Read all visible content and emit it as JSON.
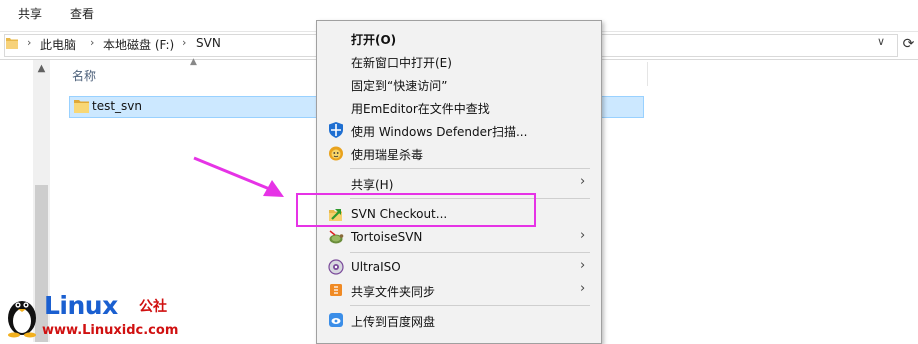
{
  "ribbon": {
    "tabs": [
      "共享",
      "查看"
    ]
  },
  "address": {
    "crumbs": [
      "此电脑",
      "本地磁盘 (F:)",
      "SVN"
    ],
    "separator": "›",
    "dropdown_glyph": "∨",
    "refresh_glyph": "⟳"
  },
  "file_list": {
    "column_name": "名称",
    "items": [
      {
        "name": "test_svn"
      }
    ]
  },
  "context_menu": {
    "items": [
      {
        "label": "打开(O)",
        "bold": true
      },
      {
        "label": "在新窗口中打开(E)"
      },
      {
        "label": "固定到“快速访问”"
      },
      {
        "label": "用EmEditor在文件中查找"
      },
      {
        "label": "使用 Windows Defender扫描...",
        "icon": "windows-defender-icon"
      },
      {
        "label": "使用瑞星杀毒",
        "icon": "rising-antivirus-icon"
      },
      {
        "label": "共享(H)",
        "submenu": true
      },
      {
        "label": "SVN Checkout...",
        "icon": "svn-checkout-icon"
      },
      {
        "label": "TortoiseSVN",
        "icon": "tortoisesvn-icon",
        "submenu": true
      },
      {
        "label": "UltraISO",
        "icon": "ultraiso-icon",
        "submenu": true
      },
      {
        "label": "共享文件夹同步",
        "icon": "folder-sync-icon",
        "submenu": true
      },
      {
        "label": "上传到百度网盘",
        "icon": "baidu-netdisk-icon"
      }
    ],
    "submenu_glyph": "›"
  },
  "annotation": {
    "color": "#e633e6"
  },
  "watermark": {
    "brand": "Linux",
    "suffix": "公社",
    "url": "www.Linuxidc.com"
  }
}
